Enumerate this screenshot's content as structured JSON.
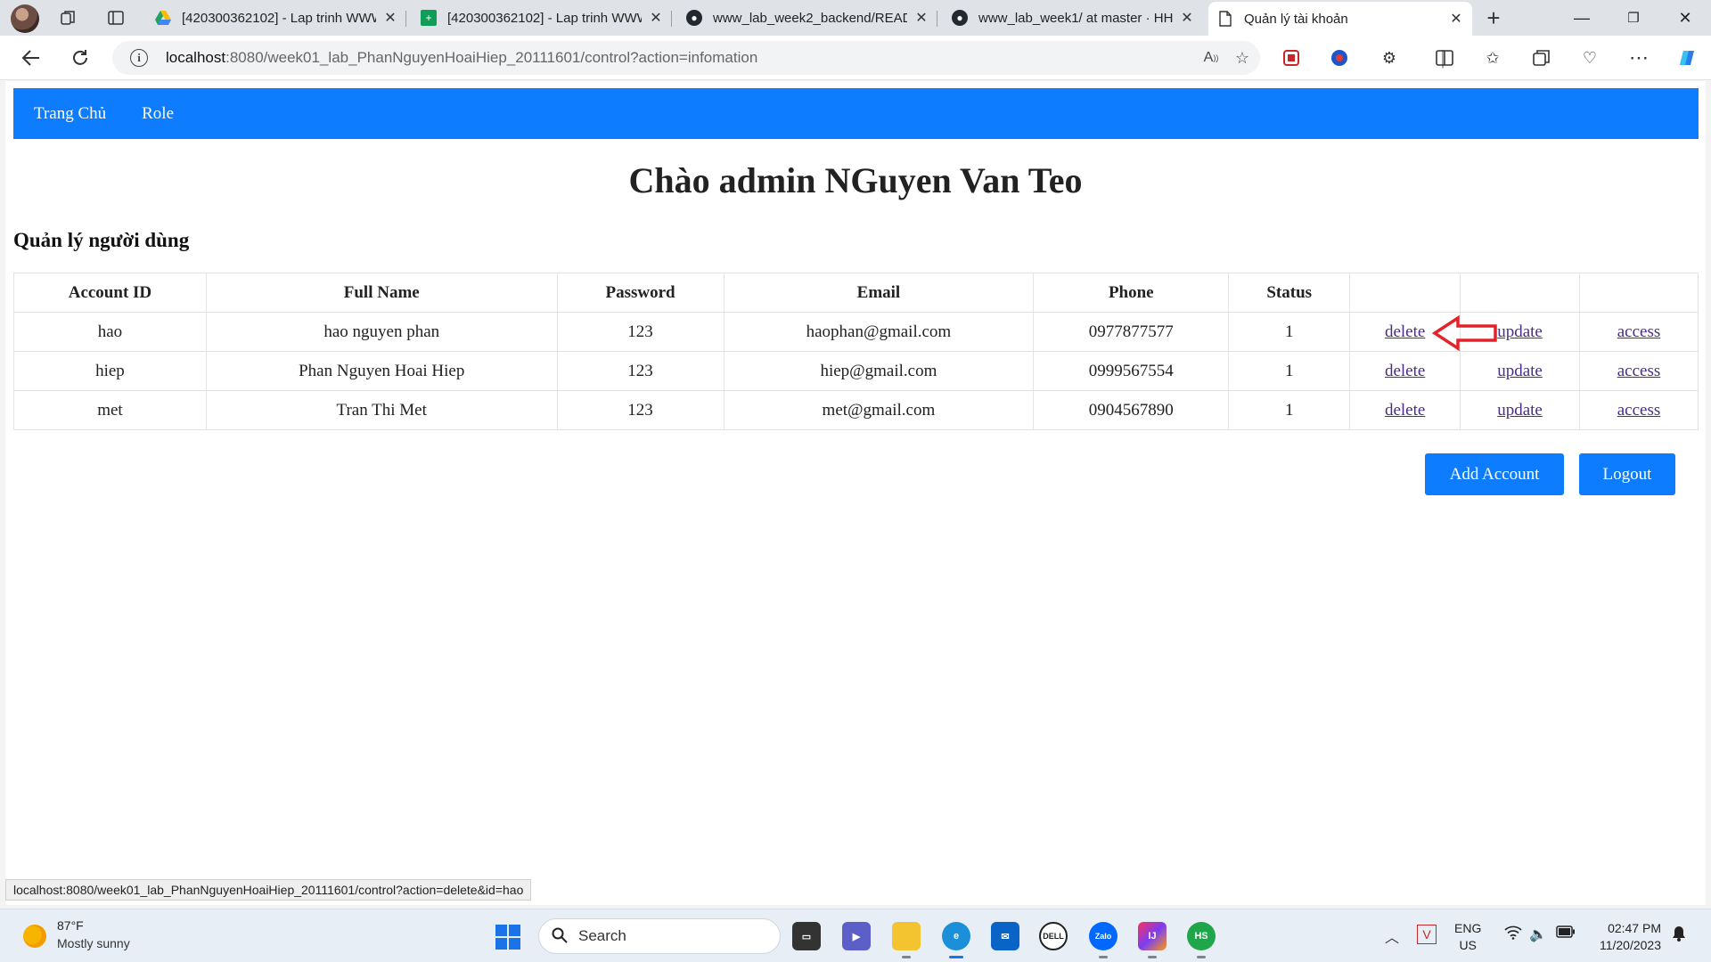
{
  "browser": {
    "tabs": [
      {
        "title": "[420300362102] - Lap trinh WWW",
        "favicon": "google-drive-icon",
        "active": false
      },
      {
        "title": "[420300362102] - Lap trinh WWW",
        "favicon": "google-sheets-icon",
        "active": false
      },
      {
        "title": "www_lab_week2_backend/README",
        "favicon": "github-icon",
        "active": false
      },
      {
        "title": "www_lab_week1/ at master · HHiep",
        "favicon": "github-icon",
        "active": false
      },
      {
        "title": "Quản lý tài khoản",
        "favicon": "page-icon",
        "active": true
      }
    ],
    "address": {
      "host": "localhost",
      "rest": ":8080/week01_lab_PhanNguyenHoaiHiep_20111601/control?action=infomation"
    }
  },
  "page": {
    "nav": {
      "home": "Trang Chủ",
      "role": "Role"
    },
    "greeting": "Chào admin NGuyen Van Teo",
    "section_title": "Quản lý người dùng",
    "table": {
      "headers": [
        "Account ID",
        "Full Name",
        "Password",
        "Email",
        "Phone",
        "Status",
        "",
        "",
        ""
      ],
      "rows": [
        {
          "account_id": "hao",
          "full_name": "hao nguyen phan",
          "password": "123",
          "email": "haophan@gmail.com",
          "phone": "0977877577",
          "status": "1",
          "delete": "delete",
          "update": "update",
          "access": "access"
        },
        {
          "account_id": "hiep",
          "full_name": "Phan Nguyen Hoai Hiep",
          "password": "123",
          "email": "hiep@gmail.com",
          "phone": "0999567554",
          "status": "1",
          "delete": "delete",
          "update": "update",
          "access": "access"
        },
        {
          "account_id": "met",
          "full_name": "Tran Thi Met",
          "password": "123",
          "email": "met@gmail.com",
          "phone": "0904567890",
          "status": "1",
          "delete": "delete",
          "update": "update",
          "access": "access"
        }
      ]
    },
    "buttons": {
      "add_account": "Add Account",
      "logout": "Logout"
    },
    "status_url": "localhost:8080/week01_lab_PhanNguyenHoaiHiep_20111601/control?action=delete&id=hao",
    "annotation_color": "#e2232a",
    "accent_color": "#0d7cff"
  },
  "taskbar": {
    "weather": {
      "temp": "87°F",
      "desc": "Mostly sunny"
    },
    "search_label": "Search",
    "lang": {
      "line1": "ENG",
      "line2": "US"
    },
    "clock": {
      "time": "02:47 PM",
      "date": "11/20/2023"
    }
  }
}
